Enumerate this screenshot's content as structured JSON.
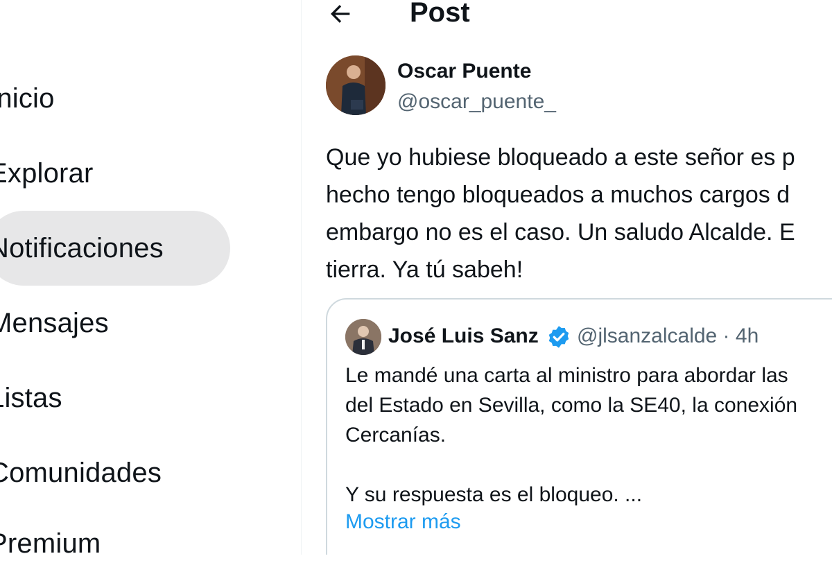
{
  "sidebar": {
    "items": [
      {
        "label": "Inicio"
      },
      {
        "label": "Explorar"
      },
      {
        "label": "Notificaciones"
      },
      {
        "label": "Mensajes"
      },
      {
        "label": "Listas"
      },
      {
        "label": "Comunidades"
      },
      {
        "label": "Premium"
      }
    ]
  },
  "header": {
    "back_icon": "arrow-left-icon",
    "title": "Post"
  },
  "post": {
    "author_name": "Oscar Puente",
    "author_handle": "@oscar_puente_",
    "text": "Que yo hubiese bloqueado a este señor es p\nhecho tengo bloqueados a muchos cargos d\nembargo no es el caso. Un saludo Alcalde. E\ntierra. Ya tú sabeh!"
  },
  "quote": {
    "author_name": "José Luis Sanz",
    "verified_icon": "verified-badge-icon",
    "handle_time": "@jlsanzalcalde · 4h",
    "text": "Le mandé una carta al ministro para abordar las\ndel Estado en Sevilla, como la SE40, la conexión\nCercanías.\n\nY su respuesta es el bloqueo. ...",
    "show_more": "Mostrar más"
  },
  "colors": {
    "accent": "#1d9bf0",
    "text_primary": "#0f1419",
    "text_secondary": "#536471",
    "active_nav_bg": "#e7e7e8",
    "border": "#cfd9de"
  }
}
